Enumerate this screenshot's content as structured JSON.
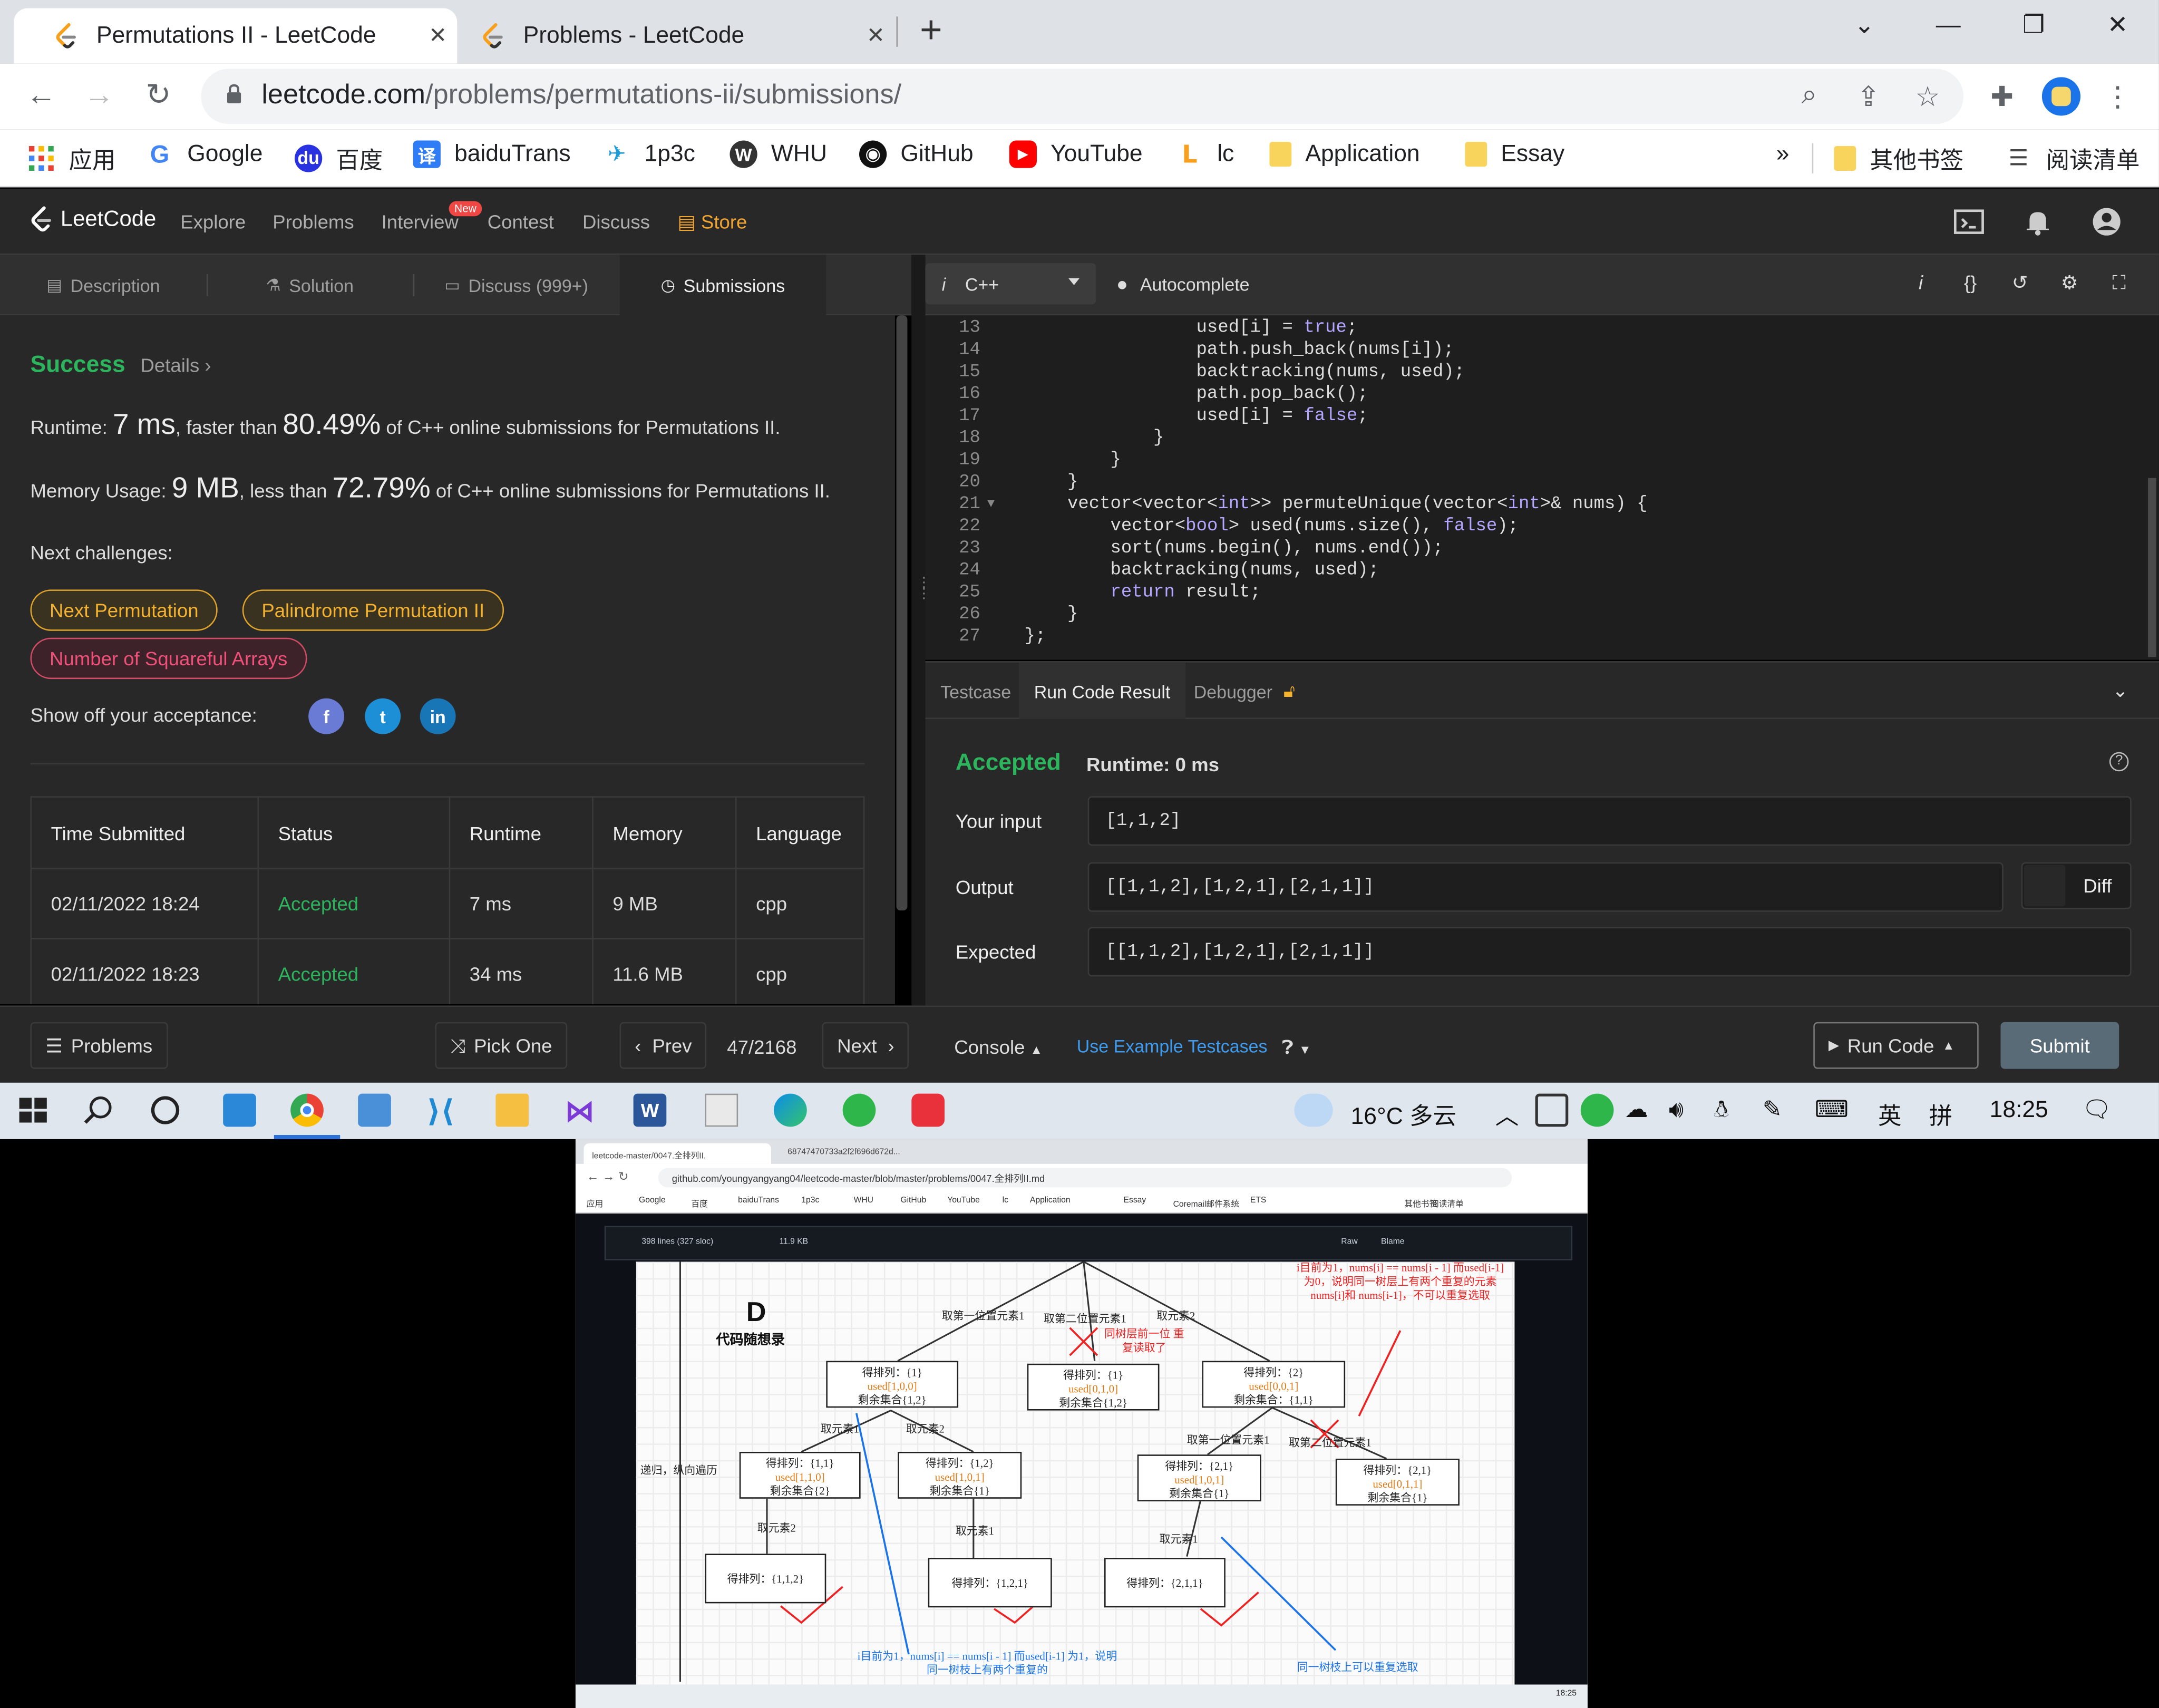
{
  "browser": {
    "tabs": [
      {
        "title": "Permutations II - LeetCode",
        "active": true
      },
      {
        "title": "Problems - LeetCode",
        "active": false
      }
    ],
    "new_tab": "+",
    "url_host": "leetcode.com",
    "url_path": "/problems/permutations-ii/submissions/",
    "bookmarks": [
      {
        "label": "应用",
        "icon": "apps-grid-icon"
      },
      {
        "label": "Google",
        "icon": "google-icon"
      },
      {
        "label": "百度",
        "icon": "baidu-icon"
      },
      {
        "label": "baiduTrans",
        "icon": "translate-icon"
      },
      {
        "label": "1p3c",
        "icon": "1p3c-icon"
      },
      {
        "label": "WHU",
        "icon": "whu-icon"
      },
      {
        "label": "GitHub",
        "icon": "github-icon"
      },
      {
        "label": "YouTube",
        "icon": "youtube-icon"
      },
      {
        "label": "lc",
        "icon": "leetcode-icon"
      },
      {
        "label": "Application",
        "icon": "folder-icon"
      },
      {
        "label": "Essay",
        "icon": "folder-icon"
      }
    ],
    "bookmarks_overflow": "»",
    "other_bookmarks": "其他书签",
    "reading_list": "阅读清单"
  },
  "leetcode_nav": {
    "logo": "LeetCode",
    "links": [
      "Explore",
      "Problems",
      "Interview",
      "Contest",
      "Discuss"
    ],
    "new_badge": "New",
    "store": "Store"
  },
  "left_tabs": [
    {
      "label": "Description",
      "icon": "description-icon"
    },
    {
      "label": "Solution",
      "icon": "flask-icon"
    },
    {
      "label": "Discuss (999+)",
      "icon": "discuss-icon"
    },
    {
      "label": "Submissions",
      "icon": "clock-icon"
    }
  ],
  "submission": {
    "status": "Success",
    "details": "Details",
    "runtime_prefix": "Runtime: ",
    "runtime_value": "7 ms",
    "runtime_mid": ", faster than ",
    "runtime_pct": "80.49%",
    "runtime_suffix": " of C++ online submissions for Permutations II.",
    "memory_prefix": "Memory Usage: ",
    "memory_value": "9 MB",
    "memory_mid": ", less than ",
    "memory_pct": "72.79%",
    "memory_suffix": " of C++ online submissions for Permutations II.",
    "next_challenges": "Next challenges:",
    "challenges": [
      {
        "label": "Next Permutation",
        "difficulty": "medium"
      },
      {
        "label": "Palindrome Permutation II",
        "difficulty": "medium"
      },
      {
        "label": "Number of Squareful Arrays",
        "difficulty": "hard"
      }
    ],
    "show_off": "Show off your acceptance:"
  },
  "submissions_table": {
    "headers": [
      "Time Submitted",
      "Status",
      "Runtime",
      "Memory",
      "Language"
    ],
    "rows": [
      [
        "02/11/2022 18:24",
        "Accepted",
        "7 ms",
        "9 MB",
        "cpp"
      ],
      [
        "02/11/2022 18:23",
        "Accepted",
        "34 ms",
        "11.6 MB",
        "cpp"
      ]
    ]
  },
  "editor": {
    "language": "C++",
    "autocomplete": "Autocomplete",
    "lines": [
      {
        "n": "13",
        "code": "                used[i] = true;"
      },
      {
        "n": "14",
        "code": "                path.push_back(nums[i]);"
      },
      {
        "n": "15",
        "code": "                backtracking(nums, used);"
      },
      {
        "n": "16",
        "code": "                path.pop_back();"
      },
      {
        "n": "17",
        "code": "                used[i] = false;"
      },
      {
        "n": "18",
        "code": "            }"
      },
      {
        "n": "19",
        "code": "        }"
      },
      {
        "n": "20",
        "code": "    }"
      },
      {
        "n": "21",
        "code": "    vector<vector<int>> permuteUnique(vector<int>& nums) {"
      },
      {
        "n": "22",
        "code": "        vector<bool> used(nums.size(), false);"
      },
      {
        "n": "23",
        "code": "        sort(nums.begin(), nums.end());"
      },
      {
        "n": "24",
        "code": "        backtracking(nums, used);"
      },
      {
        "n": "25",
        "code": "        return result;"
      },
      {
        "n": "26",
        "code": "    }"
      },
      {
        "n": "27",
        "code": "};"
      }
    ]
  },
  "console_tabs": [
    "Testcase",
    "Run Code Result",
    "Debugger"
  ],
  "run_result": {
    "status": "Accepted",
    "runtime": "Runtime: 0 ms",
    "your_input_label": "Your input",
    "your_input": "[1,1,2]",
    "output_label": "Output",
    "output": "[[1,1,2],[1,2,1],[2,1,1]]",
    "expected_label": "Expected",
    "expected": "[[1,1,2],[1,2,1],[2,1,1]]",
    "diff": "Diff"
  },
  "footer": {
    "problems": "Problems",
    "pick_one": "Pick One",
    "prev": "Prev",
    "progress": "47/2168",
    "next": "Next",
    "console": "Console",
    "use_example": "Use Example Testcases",
    "run_code": "Run Code",
    "submit": "Submit"
  },
  "taskbar": {
    "weather": "16°C 多云",
    "ime1": "英",
    "ime2": "拼",
    "time": "18:25"
  },
  "thumbnail": {
    "tab1": "leetcode-master/0047.全排列II.",
    "tab2": "68747470733a2f2f696d672d...",
    "url": "github.com/youngyangyang04/leetcode-master/blob/master/problems/0047.全排列II.md",
    "bookmarks": [
      "应用",
      "Google",
      "百度",
      "baiduTrans",
      "1p3c",
      "WHU",
      "GitHub",
      "YouTube",
      "lc",
      "Application",
      "Essay",
      "Coremail邮件系统",
      "ETS",
      "其他书签",
      "阅读清单"
    ],
    "file_info": "398 lines (327 sloc)",
    "file_size": "11.9 KB",
    "raw": "Raw",
    "blame": "Blame",
    "time": "18:25",
    "diagram": {
      "logo_letter": "D",
      "logo_text": "代码随想录",
      "nodes": [
        {
          "line1": "得排列：{1}",
          "line2": "used[1,0,0]",
          "line3": "剩余集合{1,2}"
        },
        {
          "line1": "得排列：{1}",
          "line2": "used[0,1,0]",
          "line3": "剩余集合{1,2}"
        },
        {
          "line1": "得排列：{2}",
          "line2": "used[0,0,1]",
          "line3": "剩余集合：{1,1}"
        },
        {
          "line1": "得排列：{1,1}",
          "line2": "used[1,1,0]",
          "line3": "剩余集合{2}"
        },
        {
          "line1": "得排列：{1,2}",
          "line2": "used[1,0,1]",
          "line3": "剩余集合{1}"
        },
        {
          "line1": "得排列：{2,1}",
          "line2": "used[1,0,1]",
          "line3": "剩余集合{1}"
        },
        {
          "line1": "得排列：{2,1}",
          "line2": "used[0,1,1]",
          "line3": "剩余集合{1}"
        },
        {
          "line1": "得排列：{1,1,2}"
        },
        {
          "line1": "得排列：{1,2,1}"
        },
        {
          "line1": "得排列：{2,1,1}"
        }
      ],
      "labels": [
        "取第一位置元素1",
        "取第二位置元素1",
        "取元素2",
        "取元素1",
        "取元素2",
        "取第一位置元素1",
        "取第二位置元素1",
        "取元素2",
        "取元素1",
        "取元素1",
        "递归，纵向遍历"
      ],
      "red_note_top": "i目前为1，nums[i] == nums[i - 1] 而used[i-1] 为0，说明同一树层上有两个重复的元素nums[i]和 nums[i-1]，不可以重复选取",
      "red_note_mid": "同树层前一位 重复读取了",
      "blue_note_bottom": "i目前为1，nums[i] == nums[i - 1] 而used[i-1] 为1，说明同一树枝上有两个重复的",
      "blue_note_right": "同一树枝上可以重复选取"
    }
  }
}
